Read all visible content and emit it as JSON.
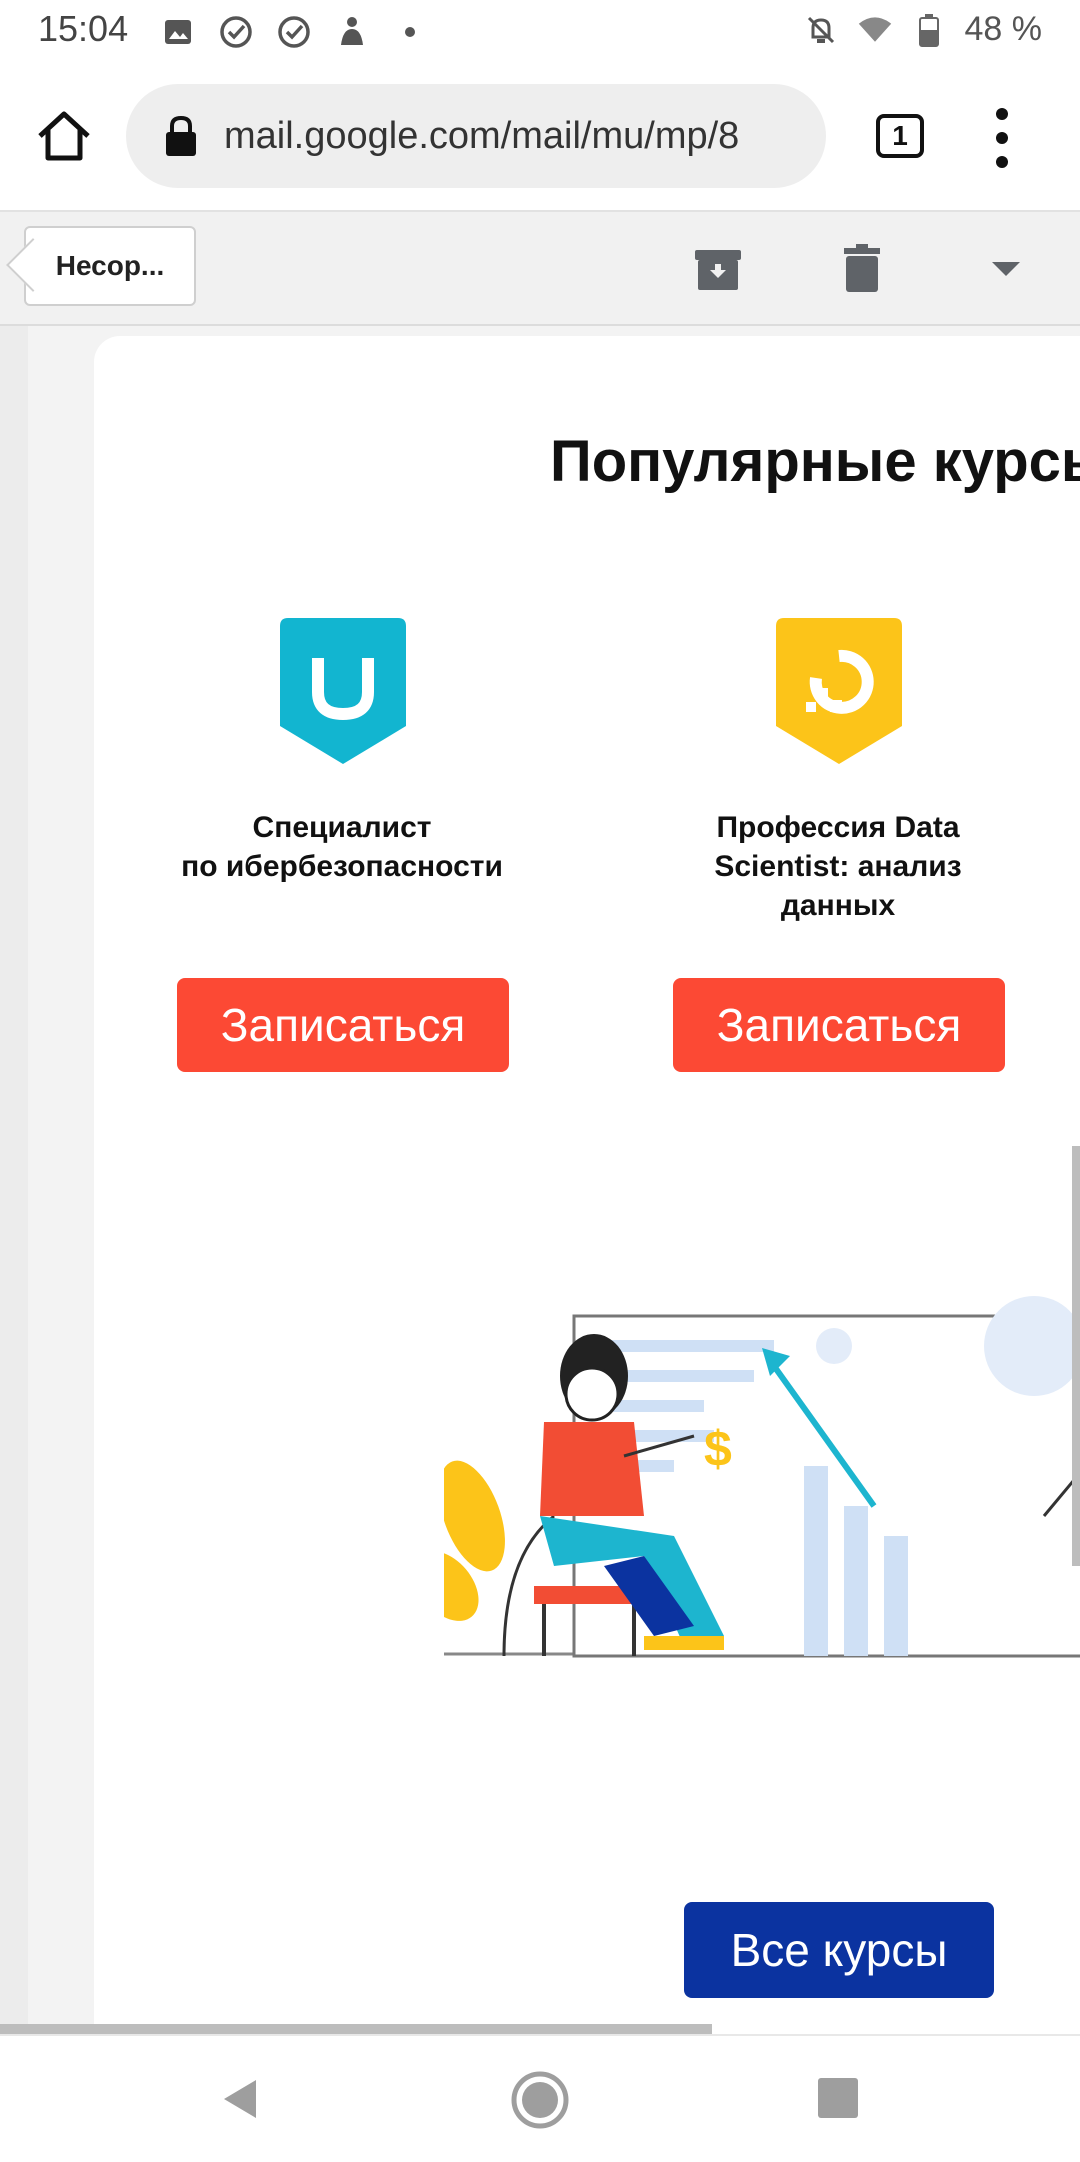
{
  "status_bar": {
    "time": "15:04",
    "battery": "48 %",
    "icons_left": [
      "image-icon",
      "check-circle-icon",
      "check-circle-icon",
      "tray-icon",
      "dot-icon"
    ],
    "icons_right": [
      "bell-off-icon",
      "wifi-icon",
      "battery-icon"
    ]
  },
  "browser": {
    "url": "mail.google.com/mail/mu/mp/8",
    "tab_count": "1"
  },
  "toolbar": {
    "back_label": "Несор..."
  },
  "email": {
    "heading": "Популярные курсы",
    "courses": [
      {
        "title_line1": "Специалист",
        "title_line2": "по ибербезопасности",
        "title_line3": "",
        "button": "Записаться",
        "icon_color": "#12b5d0"
      },
      {
        "title_line1": "Профессия Data",
        "title_line2": "Scientist: анализ",
        "title_line3": "данных",
        "button": "Записаться",
        "icon_color": "#fcc419"
      }
    ],
    "all_courses_button": "Все курсы",
    "colors": {
      "enroll": "#fc4934",
      "all_courses": "#0b33a0"
    }
  }
}
